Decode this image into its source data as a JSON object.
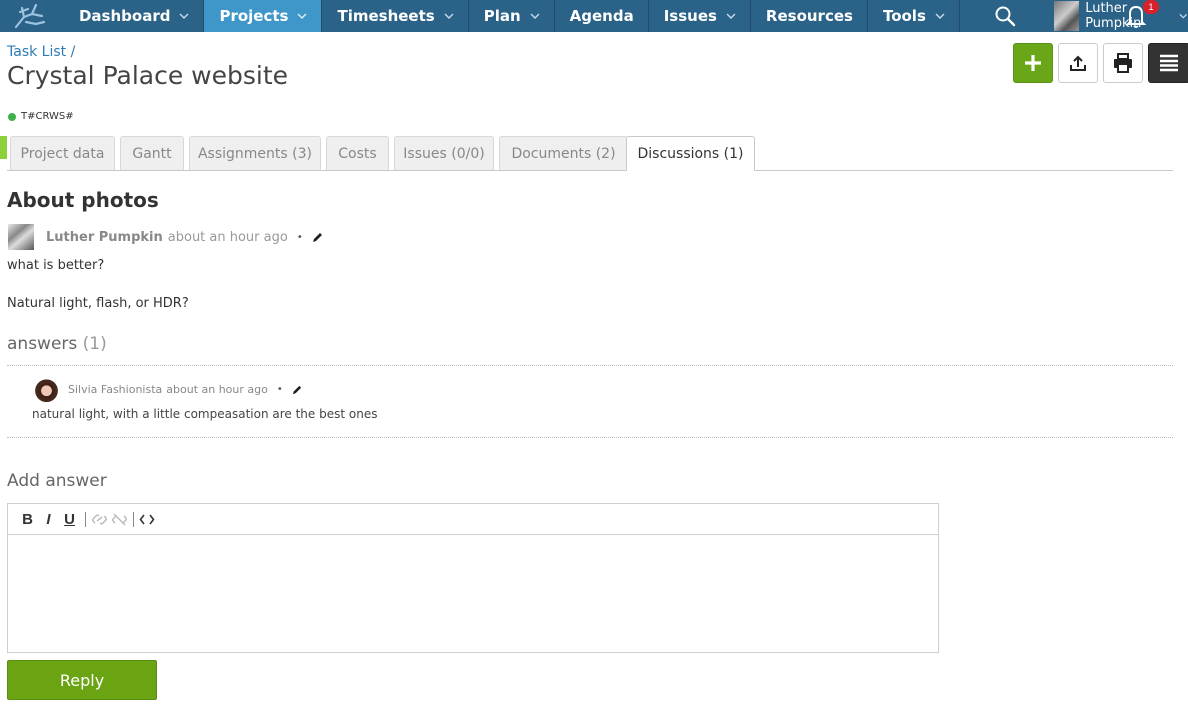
{
  "nav": {
    "items": [
      {
        "label": "Dashboard",
        "has_menu": true,
        "active": false
      },
      {
        "label": "Projects",
        "has_menu": true,
        "active": true
      },
      {
        "label": "Timesheets",
        "has_menu": true,
        "active": false
      },
      {
        "label": "Plan",
        "has_menu": true,
        "active": false
      },
      {
        "label": "Agenda",
        "has_menu": false,
        "active": false
      },
      {
        "label": "Issues",
        "has_menu": true,
        "active": false
      },
      {
        "label": "Resources",
        "has_menu": false,
        "active": false
      },
      {
        "label": "Tools",
        "has_menu": true,
        "active": false
      }
    ],
    "user_name": "Luther Pumpkin",
    "notification_count": "1",
    "bar_color": "#2b6288",
    "active_color": "#3f97c9"
  },
  "header": {
    "breadcrumb": "Task List /",
    "title": "Crystal Palace website",
    "code": "T#CRWS#",
    "status_color": "#3bb34a"
  },
  "tabs": [
    {
      "label": "Project data"
    },
    {
      "label": "Gantt"
    },
    {
      "label": "Assignments (3)"
    },
    {
      "label": "Costs"
    },
    {
      "label": "Issues (0/0)"
    },
    {
      "label": "Documents (2)"
    },
    {
      "label": "Discussions (1)",
      "active": true
    }
  ],
  "discussion": {
    "title": "About photos",
    "author": "Luther Pumpkin",
    "time": "about an hour ago",
    "separator": "•",
    "body_line1": "what is better?",
    "body_line2": "Natural light, flash, or HDR?",
    "answers_label": "answers",
    "answers_count": "(1)"
  },
  "replies": [
    {
      "author": "Silvia Fashionista",
      "time": "about an hour ago",
      "body": "natural light, with a little compeasation are the best ones"
    }
  ],
  "composer": {
    "heading": "Add answer",
    "toolbar": {
      "bold": "B",
      "italic": "I",
      "underline": "U"
    },
    "reply_label": "Reply",
    "accent": "#6aa413"
  }
}
